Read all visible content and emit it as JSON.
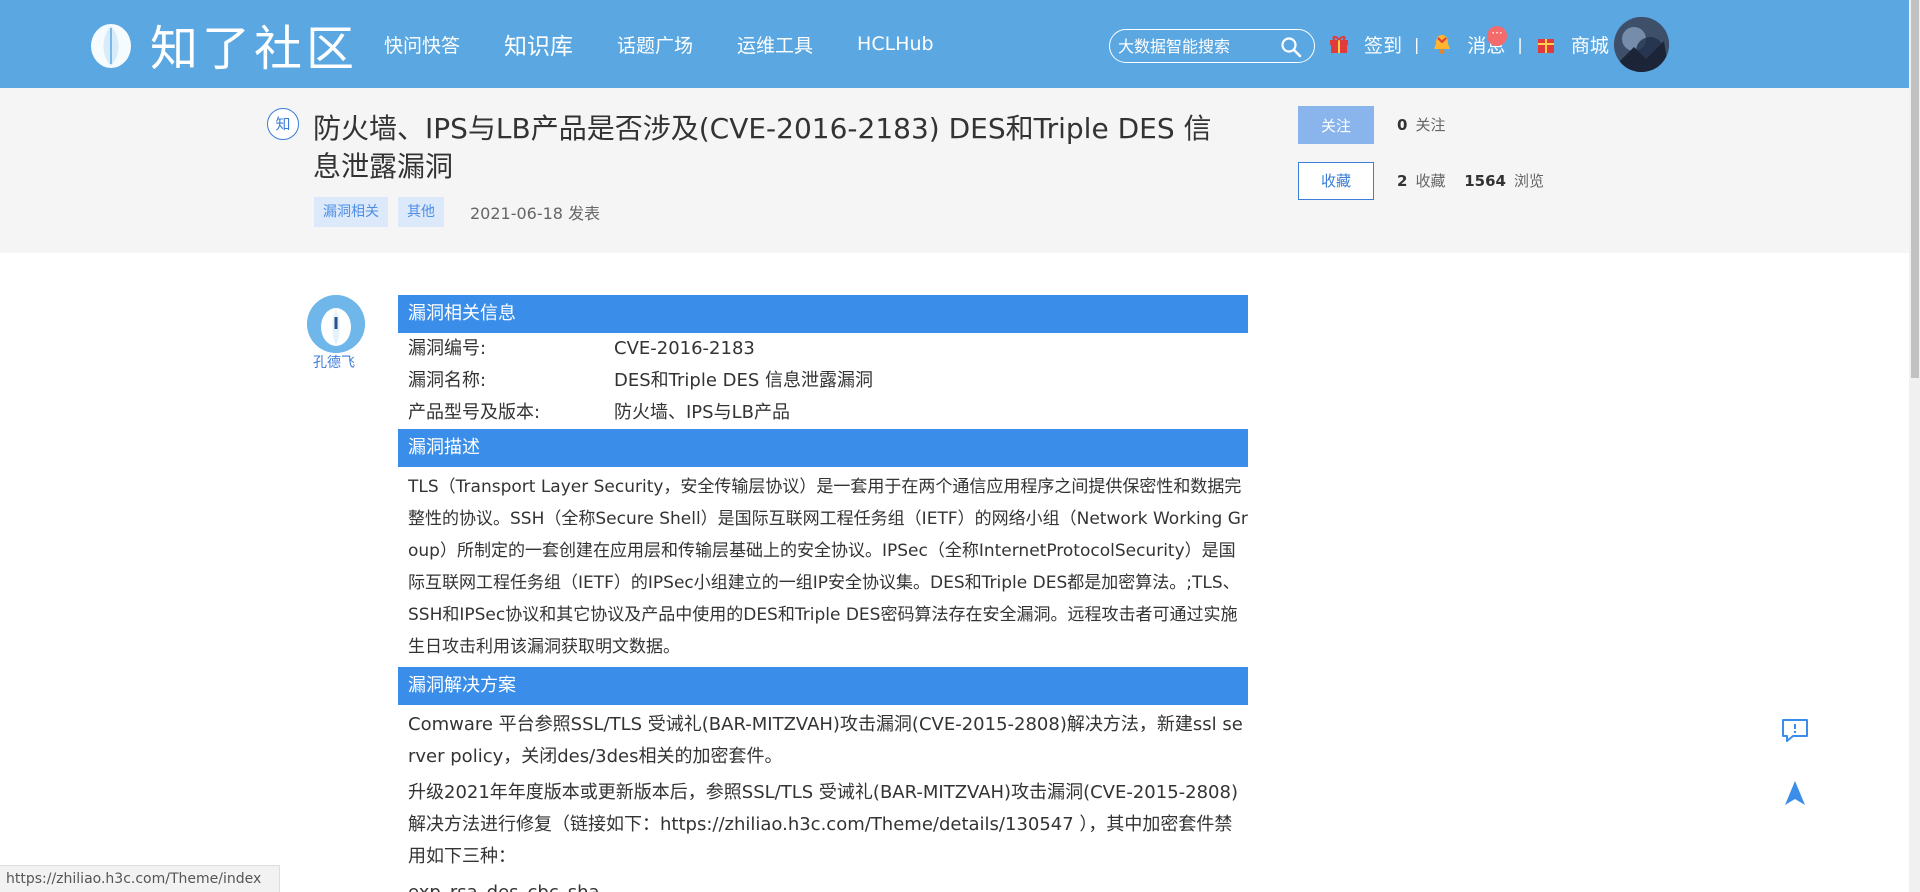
{
  "header": {
    "logo_text": "知了社区",
    "nav": [
      {
        "label": "快问快答",
        "active": false
      },
      {
        "label": "知识库",
        "active": true
      },
      {
        "label": "话题广场",
        "active": false
      },
      {
        "label": "运维工具",
        "active": false
      },
      {
        "label": "HCLHub",
        "active": false
      }
    ],
    "search_placeholder": "大数据智能搜索",
    "checkin_label": "签到",
    "messages_label": "消息",
    "messages_badge": "···",
    "shop_label": "商城",
    "separator": "|"
  },
  "article": {
    "kind_badge": "知",
    "title": "防火墙、IPS与LB产品是否涉及(CVE-2016-2183) DES和Triple DES 信息泄露漏洞",
    "tags": [
      "漏洞相关",
      "其他"
    ],
    "date": "2021-06-18 发表",
    "follow_label": "关注",
    "favorite_label": "收藏",
    "followers_count": "0",
    "followers_label": "关注",
    "favorites_count": "2",
    "favorites_label": "收藏",
    "views_count": "1564",
    "views_label": "浏览",
    "author": "孔德飞"
  },
  "content": {
    "sec1_title": "漏洞相关信息",
    "info": [
      {
        "key": "漏洞编号:",
        "value": "CVE-2016-2183"
      },
      {
        "key": "漏洞名称:",
        "value": "DES和Triple DES 信息泄露漏洞"
      },
      {
        "key": "产品型号及版本:",
        "value": "防火墙、IPS与LB产品"
      }
    ],
    "sec2_title": "漏洞描述",
    "description": "TLS（Transport Layer Security，安全传输层协议）是一套用于在两个通信应用程序之间提供保密性和数据完整性的协议。SSH（全称Secure Shell）是国际互联网工程任务组（IETF）的网络小组（Network Working Group）所制定的一套创建在应用层和传输层基础上的安全协议。IPSec（全称InternetProtocolSecurity）是国际互联网工程任务组（IETF）的IPSec小组建立的一组IP安全协议集。DES和Triple DES都是加密算法。;TLS、SSH和IPSec协议和其它协议及产品中使用的DES和Triple DES密码算法存在安全漏洞。远程攻击者可通过实施生日攻击利用该漏洞获取明文数据。",
    "sec3_title": "漏洞解决方案",
    "solution_1": "Comware 平台参照SSL/TLS 受诫礼(BAR-MITZVAH)攻击漏洞(CVE-2015-2808)解决方法，新建ssl server policy，关闭des/3des相关的加密套件。",
    "solution_2": "  升级2021年年度版本或更新版本后，参照SSL/TLS 受诫礼(BAR-MITZVAH)攻击漏洞(CVE-2015-2808)解决方法进行修复（链接如下：https://zhiliao.h3c.com/Theme/details/130547 ），其中加密套件禁用如下三种：",
    "solution_3": "exp_rsa_des_cbc_sha"
  },
  "status_url": "https://zhiliao.h3c.com/Theme/index"
}
